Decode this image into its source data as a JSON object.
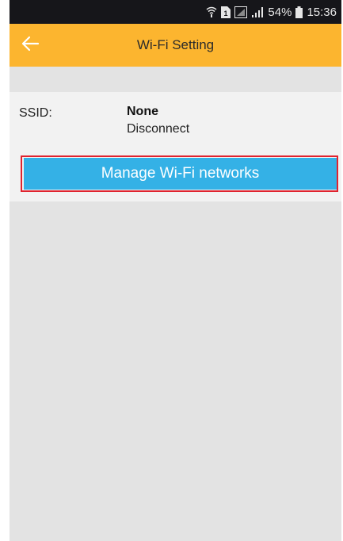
{
  "status_bar": {
    "battery_percent": "54%",
    "time": "15:36",
    "icons": [
      "wifi-calling-icon",
      "sim-1-icon",
      "signal-icon",
      "signal-icon",
      "battery-icon"
    ]
  },
  "app_bar": {
    "title": "Wi-Fi Setting",
    "back_icon": "arrow-left-icon",
    "background_color": "#fcb52f"
  },
  "ssid": {
    "label": "SSID:",
    "value": "None",
    "status": "Disconnect"
  },
  "actions": {
    "manage_button_label": "Manage Wi-Fi networks",
    "manage_button_color": "#34b1e6",
    "highlight_color": "#e0232e"
  }
}
